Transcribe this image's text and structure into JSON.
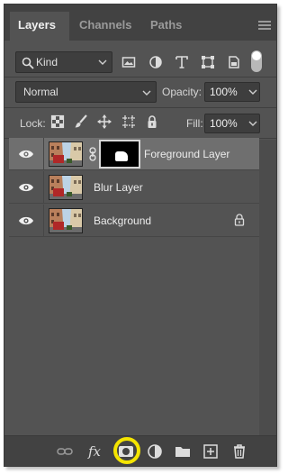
{
  "tabs": [
    {
      "label": "Layers",
      "active": true
    },
    {
      "label": "Channels",
      "active": false
    },
    {
      "label": "Paths",
      "active": false
    }
  ],
  "filter": {
    "kind_label": "Kind",
    "icons": [
      "image-filter-icon",
      "adjustment-filter-icon",
      "type-filter-icon",
      "shape-filter-icon",
      "smart-object-filter-icon"
    ]
  },
  "blend": {
    "mode": "Normal",
    "opacity_label": "Opacity:",
    "opacity_value": "100%"
  },
  "lock": {
    "label": "Lock:",
    "icons": [
      "lock-transparent-pixels-icon",
      "lock-image-pixels-icon",
      "lock-position-icon",
      "lock-artboard-icon",
      "lock-all-icon"
    ],
    "fill_label": "Fill:",
    "fill_value": "100%"
  },
  "layers": [
    {
      "name": "Foreground Layer",
      "selected": true,
      "has_mask": true,
      "locked": false
    },
    {
      "name": "Blur Layer",
      "selected": false,
      "has_mask": false,
      "locked": false
    },
    {
      "name": "Background",
      "selected": false,
      "has_mask": false,
      "locked": true
    }
  ],
  "bottom_icons": [
    "link-layers-icon",
    "fx-icon",
    "add-mask-icon",
    "adjustment-layer-icon",
    "new-group-icon",
    "new-layer-icon",
    "trash-icon"
  ],
  "fx_label": "fx",
  "colors": {
    "panel": "#535353",
    "tabbar": "#424242",
    "selected_layer": "#6f6f6f",
    "highlight": "#f4e400"
  }
}
